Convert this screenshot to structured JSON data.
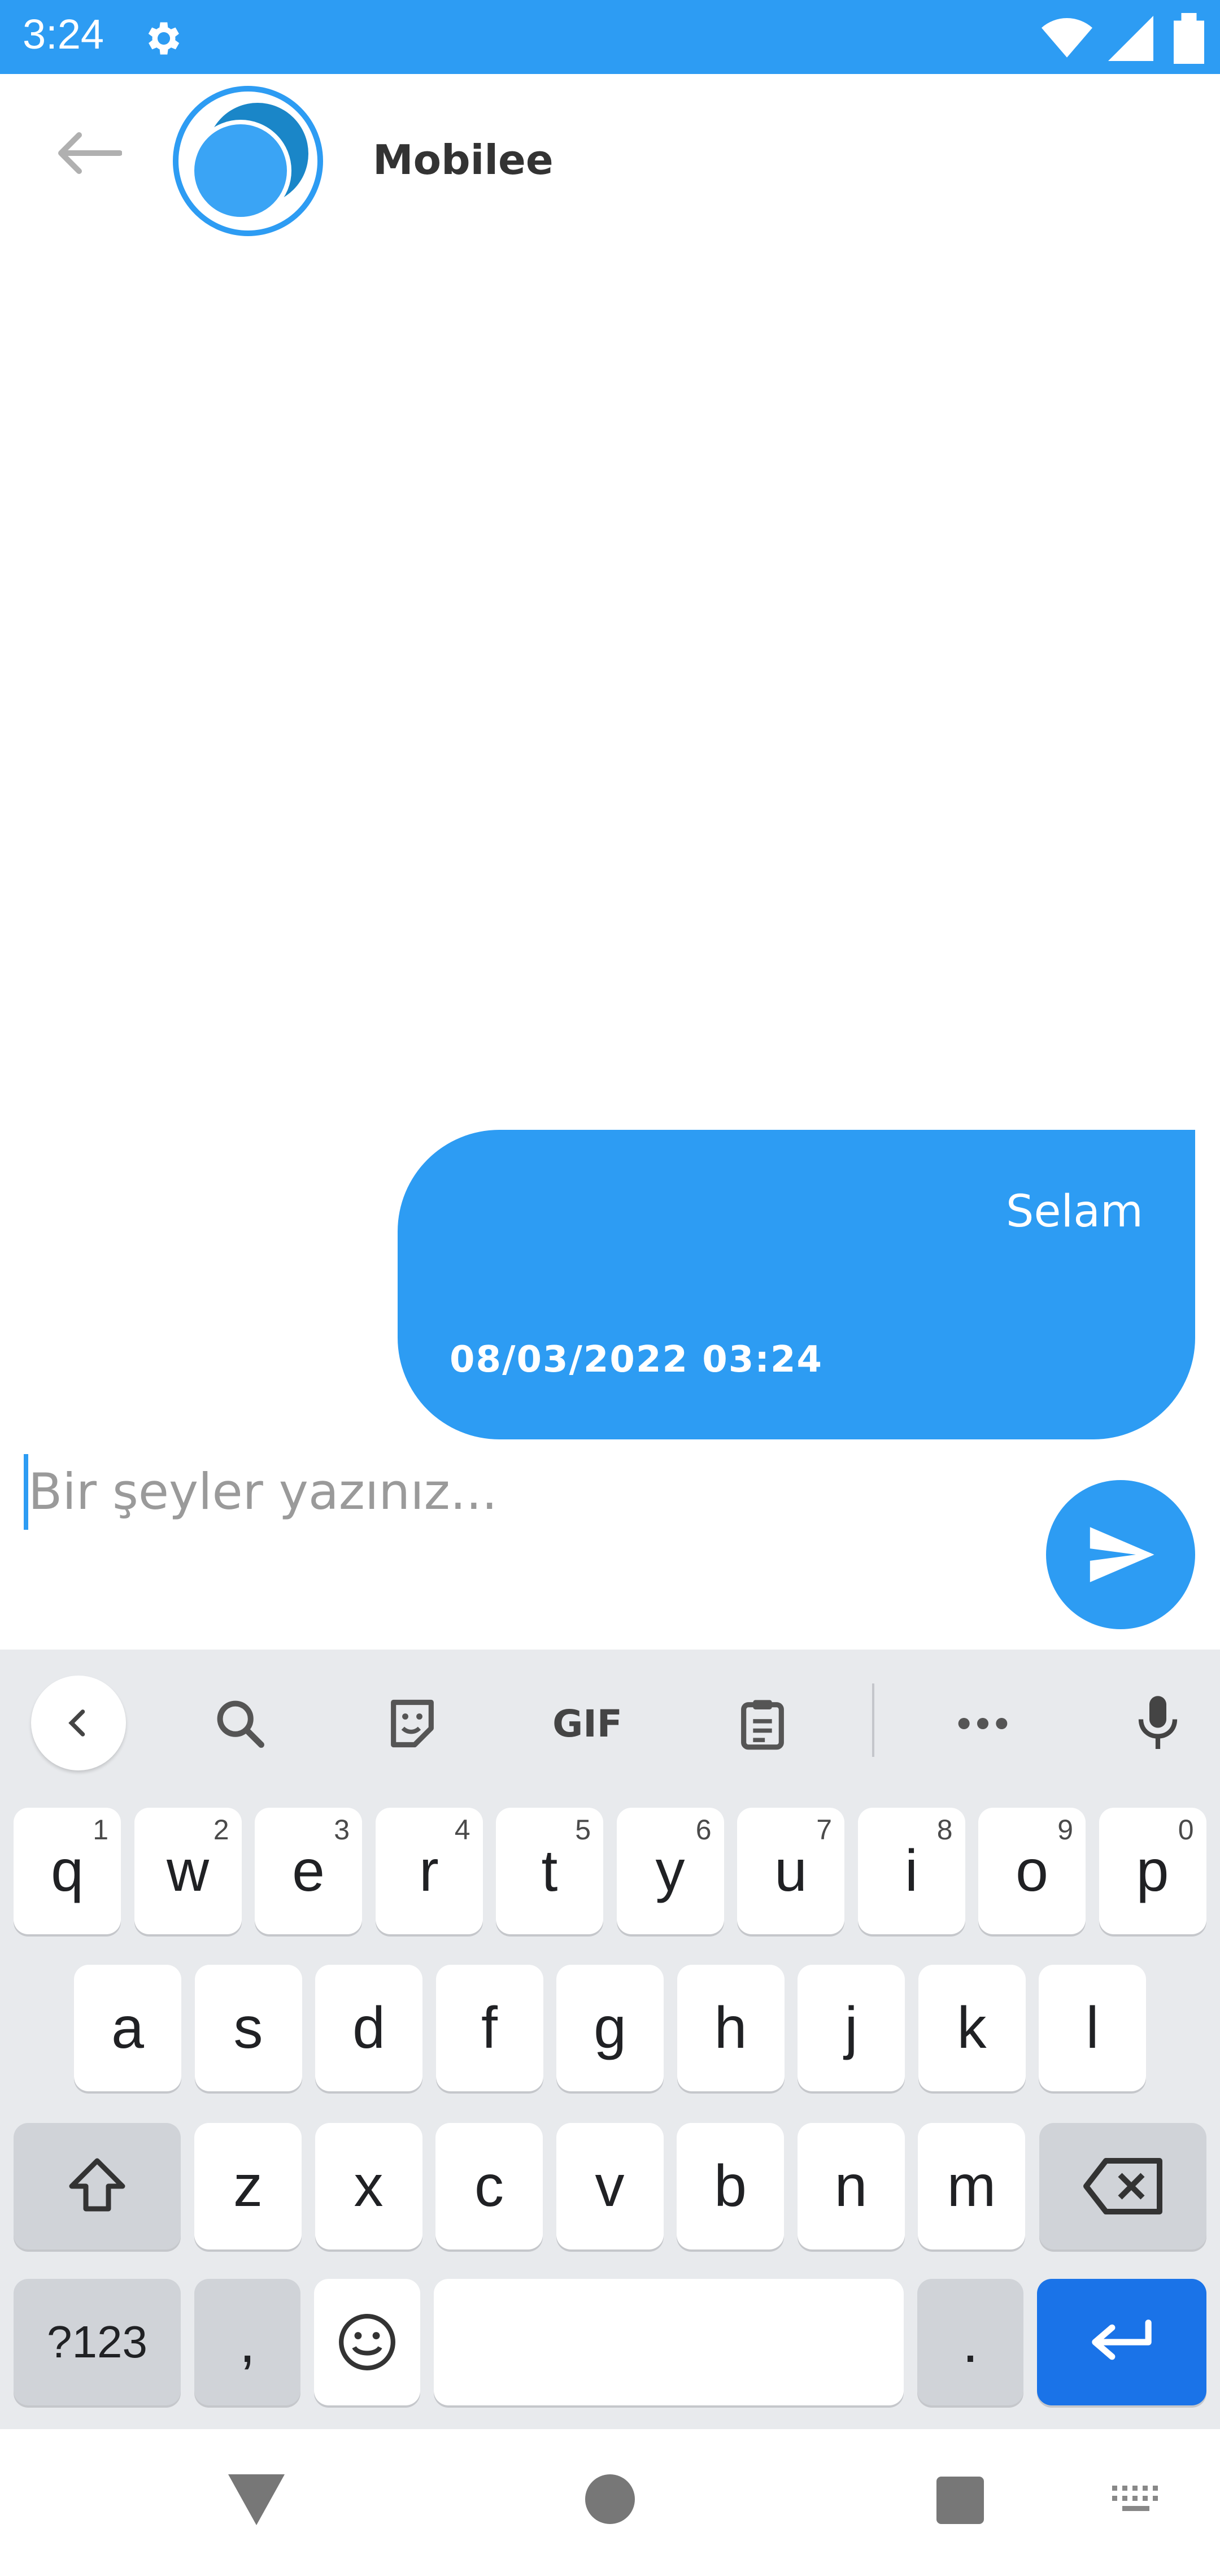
{
  "status_bar": {
    "time": "3:24",
    "bg_color": "#2d9cf3"
  },
  "header": {
    "contact_name": "Mobilee"
  },
  "messages": [
    {
      "text": "Selam",
      "timestamp": "08/03/2022 03:24"
    }
  ],
  "composer": {
    "placeholder": "Bir şeyler yazınız..."
  },
  "keyboard": {
    "toolbar": {
      "gif_label": "GIF"
    },
    "rows": {
      "row1": [
        {
          "l": "q",
          "n": "1"
        },
        {
          "l": "w",
          "n": "2"
        },
        {
          "l": "e",
          "n": "3"
        },
        {
          "l": "r",
          "n": "4"
        },
        {
          "l": "t",
          "n": "5"
        },
        {
          "l": "y",
          "n": "6"
        },
        {
          "l": "u",
          "n": "7"
        },
        {
          "l": "i",
          "n": "8"
        },
        {
          "l": "o",
          "n": "9"
        },
        {
          "l": "p",
          "n": "0"
        }
      ],
      "row2": [
        "a",
        "s",
        "d",
        "f",
        "g",
        "h",
        "j",
        "k",
        "l"
      ],
      "row3": [
        "z",
        "x",
        "c",
        "v",
        "b",
        "n",
        "m"
      ]
    },
    "symbols_label": "?123",
    "comma_label": ",",
    "period_label": "."
  },
  "colors": {
    "accent": "#2d9cf3",
    "enter_key": "#1a73e8"
  }
}
